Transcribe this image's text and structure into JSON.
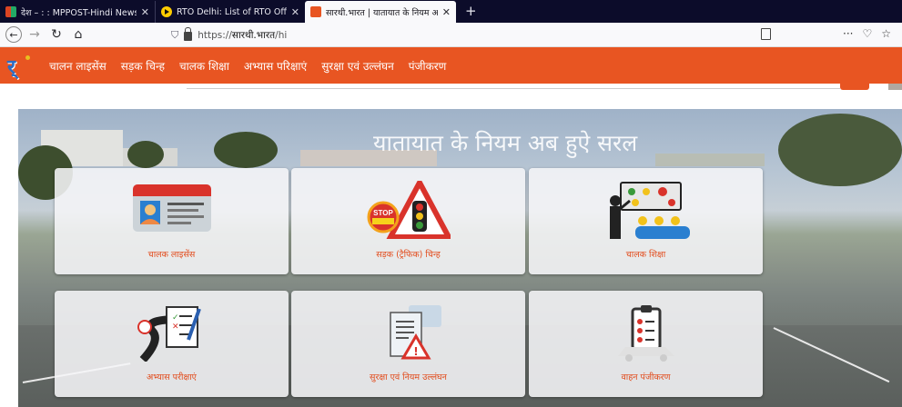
{
  "browser": {
    "tabs": [
      {
        "title": "देश – : : MPPOST-Hindi News Po",
        "active": false
      },
      {
        "title": "RTO Delhi: List of RTO Offices in",
        "active": false
      },
      {
        "title": "सारथी.भारत | यातायात के नियम अब",
        "active": true
      }
    ],
    "url_prefix": "https://",
    "url_host": "सारथी.भारत",
    "url_path": "/hi",
    "menu_dots": "···"
  },
  "site": {
    "logo_text": "र्",
    "nav": [
      "चालन लाइसेंस",
      "सड़क चिन्ह",
      "चालक शिक्षा",
      "अभ्यास परिक्षाएं",
      "सुरक्षा एवं उल्लंघन",
      "पंजीकरण"
    ]
  },
  "hero": {
    "title": "यातायात के नियम अब हुऐ सरल"
  },
  "cards": [
    {
      "label": "चालक लाइसेंस",
      "icon": "license-card-icon"
    },
    {
      "label": "सड़क (ट्रैफिक) चिन्ह",
      "icon": "traffic-sign-icon"
    },
    {
      "label": "चालक शिक्षा",
      "icon": "driver-education-icon"
    },
    {
      "label": "अभ्यास परीक्षाएं",
      "icon": "practice-test-icon"
    },
    {
      "label": "सुरक्षा एवं नियम उल्लंघन",
      "icon": "safety-violation-icon"
    },
    {
      "label": "वाहन पंजीकरण",
      "icon": "vehicle-registration-icon"
    }
  ],
  "colors": {
    "brand": "#e85522",
    "card_label": "#e24a1a"
  }
}
